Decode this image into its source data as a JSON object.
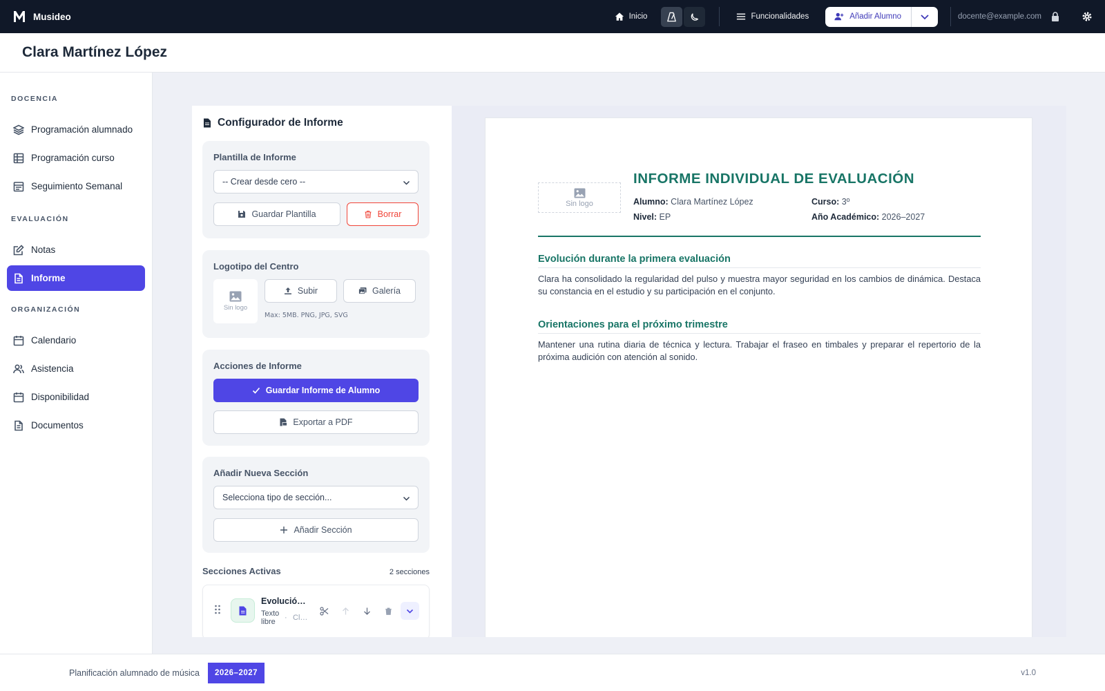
{
  "app": {
    "name": "Musideo"
  },
  "topnav": {
    "home_label": "Inicio",
    "features_label": "Funcionalidades",
    "add_student_label": "Añadir Alumno",
    "user_email": "docente@example.com"
  },
  "page": {
    "title": "Clara Martínez López"
  },
  "sidebar": {
    "sections": [
      {
        "label": "DOCENCIA",
        "items": [
          {
            "label": "Programación alumnado",
            "icon": "layers-icon"
          },
          {
            "label": "Programación curso",
            "icon": "table-icon"
          },
          {
            "label": "Seguimiento Semanal",
            "icon": "calendar-week-icon"
          }
        ]
      },
      {
        "label": "EVALUACIÓN",
        "items": [
          {
            "label": "Notas",
            "icon": "edit-icon"
          },
          {
            "label": "Informe",
            "icon": "document-icon",
            "active": true
          }
        ]
      },
      {
        "label": "ORGANIZACIÓN",
        "items": [
          {
            "label": "Calendario",
            "icon": "calendar-icon"
          },
          {
            "label": "Asistencia",
            "icon": "users-icon"
          },
          {
            "label": "Disponibilidad",
            "icon": "calendar-icon"
          },
          {
            "label": "Documentos",
            "icon": "document-icon"
          }
        ]
      }
    ]
  },
  "config": {
    "title": "Configurador de Informe",
    "template": {
      "title": "Plantilla de Informe",
      "selected": "-- Crear desde cero --",
      "save_label": "Guardar Plantilla",
      "delete_label": "Borrar"
    },
    "logo": {
      "title": "Logotipo del Centro",
      "placeholder": "Sin logo",
      "upload_label": "Subir",
      "gallery_label": "Galería",
      "hint": "Max: 5MB. PNG, JPG, SVG"
    },
    "actions": {
      "title": "Acciones de Informe",
      "save_report_label": "Guardar Informe de Alumno",
      "export_label": "Exportar a PDF"
    },
    "add_section": {
      "title": "Añadir Nueva Sección",
      "select_placeholder": "Selecciona tipo de sección...",
      "button_label": "Añadir Sección"
    },
    "active_sections": {
      "title": "Secciones Activas",
      "count_label": "2 secciones",
      "items": [
        {
          "name": "Evolución durante la primera evaluación",
          "type": "Texto libre",
          "sub": "Clara"
        }
      ]
    }
  },
  "report": {
    "logo_placeholder": "Sin logo",
    "title": "INFORME INDIVIDUAL DE EVALUACIÓN",
    "meta": {
      "alumno_label": "Alumno:",
      "alumno": "Clara Martínez López",
      "curso_label": "Curso:",
      "curso": "3º",
      "nivel_label": "Nivel:",
      "nivel": "EP",
      "anio_label": "Año Académico:",
      "anio": "2026–2027"
    },
    "sections": [
      {
        "heading": "Evolución durante la primera evaluación",
        "body": "Clara ha consolidado la regularidad del pulso y muestra mayor seguridad en los cambios de dinámica. Destaca su constancia en el estudio y su participación en el conjunto."
      },
      {
        "heading": "Orientaciones para el próximo trimestre",
        "body": "Mantener una rutina diaria de técnica y lectura. Trabajar el fraseo en timbales y preparar el repertorio de la próxima audición con atención al sonido."
      }
    ]
  },
  "footer": {
    "text": "Planificación alumnado de música",
    "year_badge": "2026–2027",
    "version": "v1.0"
  },
  "colors": {
    "accent": "#4f46e5",
    "report_teal": "#187566",
    "topbar": "#101828",
    "danger": "#f04438"
  }
}
